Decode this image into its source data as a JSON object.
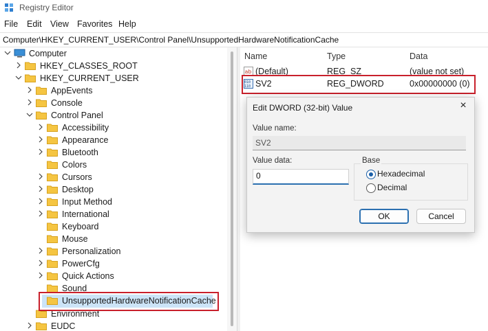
{
  "window": {
    "title": "Registry Editor"
  },
  "menu": [
    "File",
    "Edit",
    "View",
    "Favorites",
    "Help"
  ],
  "address": "Computer\\HKEY_CURRENT_USER\\Control Panel\\UnsupportedHardwareNotificationCache",
  "tree": {
    "root": "Computer",
    "hkcr": "HKEY_CLASSES_ROOT",
    "hkcu": "HKEY_CURRENT_USER",
    "appevents": "AppEvents",
    "console": "Console",
    "control_panel": "Control Panel",
    "children": [
      "Accessibility",
      "Appearance",
      "Bluetooth",
      "Colors",
      "Cursors",
      "Desktop",
      "Input Method",
      "International",
      "Keyboard",
      "Mouse",
      "Personalization",
      "PowerCfg",
      "Quick Actions",
      "Sound",
      "UnsupportedHardwareNotificationCache"
    ],
    "environment": "Environment",
    "eudc": "EUDC"
  },
  "list": {
    "headers": {
      "name": "Name",
      "type": "Type",
      "data": "Data"
    },
    "rows": [
      {
        "name": "(Default)",
        "type": "REG_SZ",
        "data": "(value not set)",
        "icon": "string-value-icon"
      },
      {
        "name": "SV2",
        "type": "REG_DWORD",
        "data": "0x00000000 (0)",
        "icon": "dword-value-icon"
      }
    ]
  },
  "dialog": {
    "title": "Edit DWORD (32-bit) Value",
    "value_name_label": "Value name:",
    "value_name": "SV2",
    "value_data_label": "Value data:",
    "value_data": "0",
    "base_label": "Base",
    "hex_label": "Hexadecimal",
    "dec_label": "Decimal",
    "selected_base": "Hexadecimal",
    "ok_label": "OK",
    "cancel_label": "Cancel"
  },
  "colors": {
    "highlight_border": "#c8202b",
    "selection": "#cce4f7",
    "accent": "#2a6fb0"
  }
}
